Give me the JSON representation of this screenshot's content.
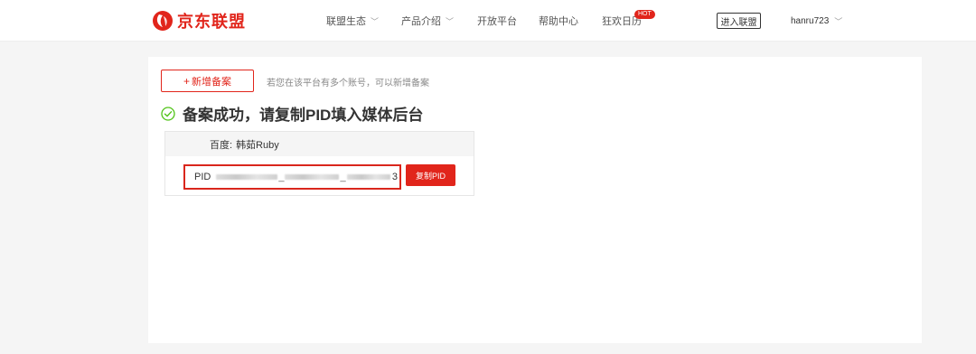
{
  "header": {
    "brand": "京东联盟",
    "nav": [
      {
        "label": "联盟生态",
        "has_dropdown": true
      },
      {
        "label": "产品介绍",
        "has_dropdown": true
      },
      {
        "label": "开放平台",
        "has_dropdown": false
      },
      {
        "label": "帮助中心",
        "has_dropdown": false
      },
      {
        "label": "狂欢日历",
        "has_dropdown": false,
        "badge": "HOT"
      }
    ],
    "enter_button": "进入联盟",
    "username": "hanru723"
  },
  "main": {
    "add_button": "新增备案",
    "add_hint": "若您在该平台有多个账号，可以新增备案",
    "success_title": "备案成功，请复制PID填入媒体后台",
    "record": {
      "platform": "百度:",
      "account": "韩茹Ruby",
      "pid_prefix": "PID",
      "pid_suffix": "3",
      "copy_button": "复制PID"
    }
  },
  "colors": {
    "brand_red": "#e1251b",
    "success_green": "#52c41a"
  },
  "icons": [
    "jd-logo-icon",
    "chevron-down-icon",
    "plus-icon",
    "check-circle-icon"
  ]
}
